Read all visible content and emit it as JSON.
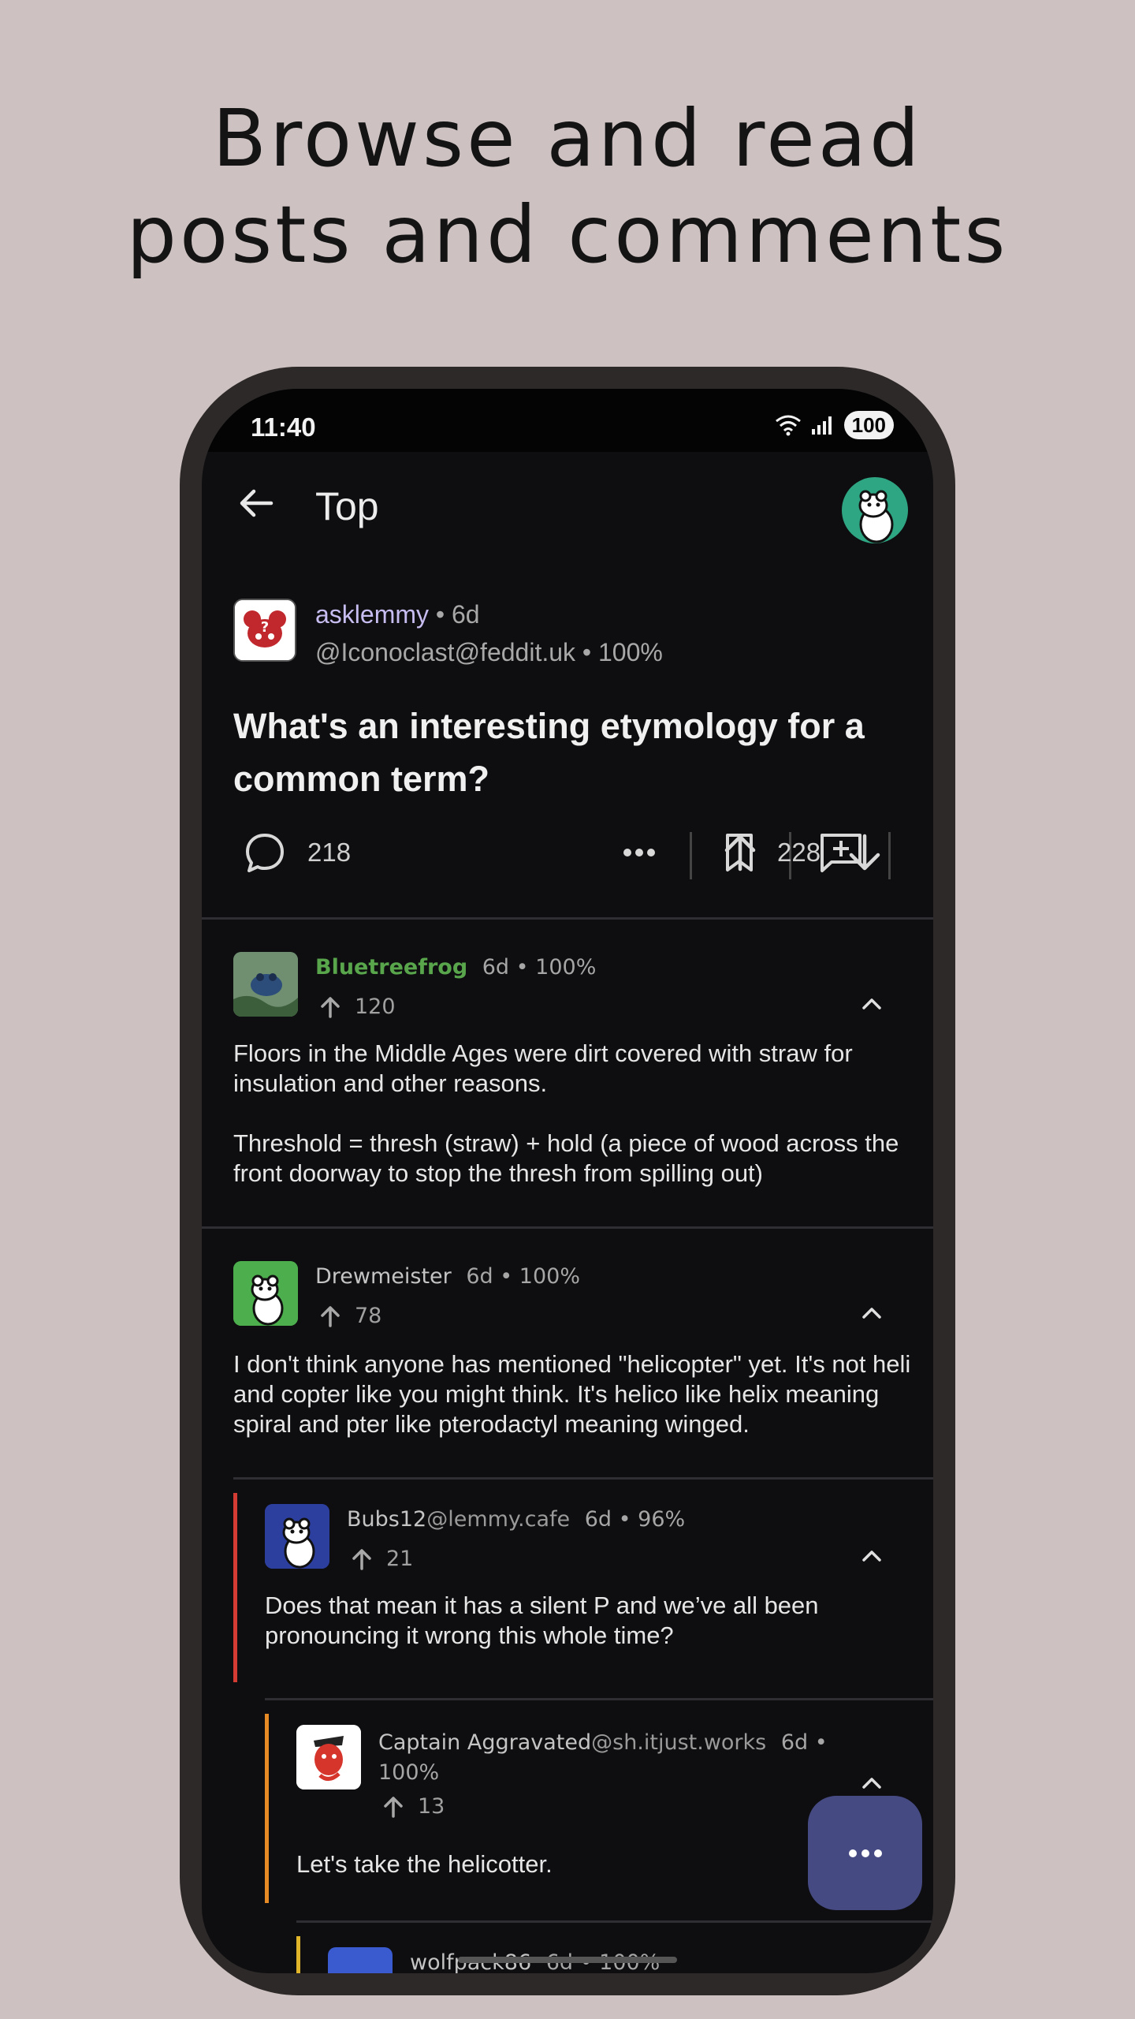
{
  "headline": {
    "line1": "Browse and read",
    "line2": "posts and comments"
  },
  "status_bar": {
    "time": "11:40",
    "battery": "100"
  },
  "top_bar": {
    "title": "Top"
  },
  "post": {
    "community": "asklemmy",
    "age": "• 6d",
    "author": "@Iconoclast@feddit.uk",
    "upvote_ratio": "• 100%",
    "title": "What's an interesting etymology for a common term?",
    "comment_count": "218",
    "score": "228"
  },
  "comments": [
    {
      "user": "Bluetreefrog",
      "instance": "",
      "meta": "6d • 100%",
      "score": "120",
      "body_p1": "Floors in the Middle Ages were dirt covered with straw for insulation and other reasons.",
      "body_p2": "Threshold = thresh (straw) + hold (a piece of wood across the front doorway to stop the thresh from spilling out)"
    },
    {
      "user": "Drewmeister",
      "instance": "",
      "meta": "6d • 100%",
      "score": "78",
      "body": "I don't think anyone has mentioned \"helicopter\" yet. It's not heli and copter like you might think. It's helico like helix meaning spiral and pter like pterodactyl meaning winged."
    },
    {
      "user": "Bubs12",
      "instance": "@lemmy.cafe",
      "meta": "6d • 96%",
      "score": "21",
      "body": "Does that mean it has a silent P and we’ve all been pronouncing it wrong this whole time?"
    },
    {
      "user": "Captain Aggravated",
      "instance": "@sh.itjust.works",
      "meta_line1": "6d •",
      "meta_line2": "100%",
      "score": "13",
      "body": "Let's take the helicotter."
    },
    {
      "user": "wolfpack86",
      "meta": "6d • 100%"
    }
  ],
  "colors": {
    "background": "#cdc2c1",
    "screen": "#0e0e10",
    "fab": "#454a82",
    "thread_red": "#d33b33",
    "thread_orange": "#e58a25",
    "thread_yellow": "#e0b52a",
    "username_green": "#58a54c"
  },
  "icons": [
    "back-arrow-icon",
    "comment-bubble-icon",
    "more-dots-icon",
    "bookmark-icon",
    "reply-icon",
    "upvote-icon",
    "downvote-icon",
    "chevron-up-icon",
    "wifi-icon",
    "signal-icon"
  ]
}
